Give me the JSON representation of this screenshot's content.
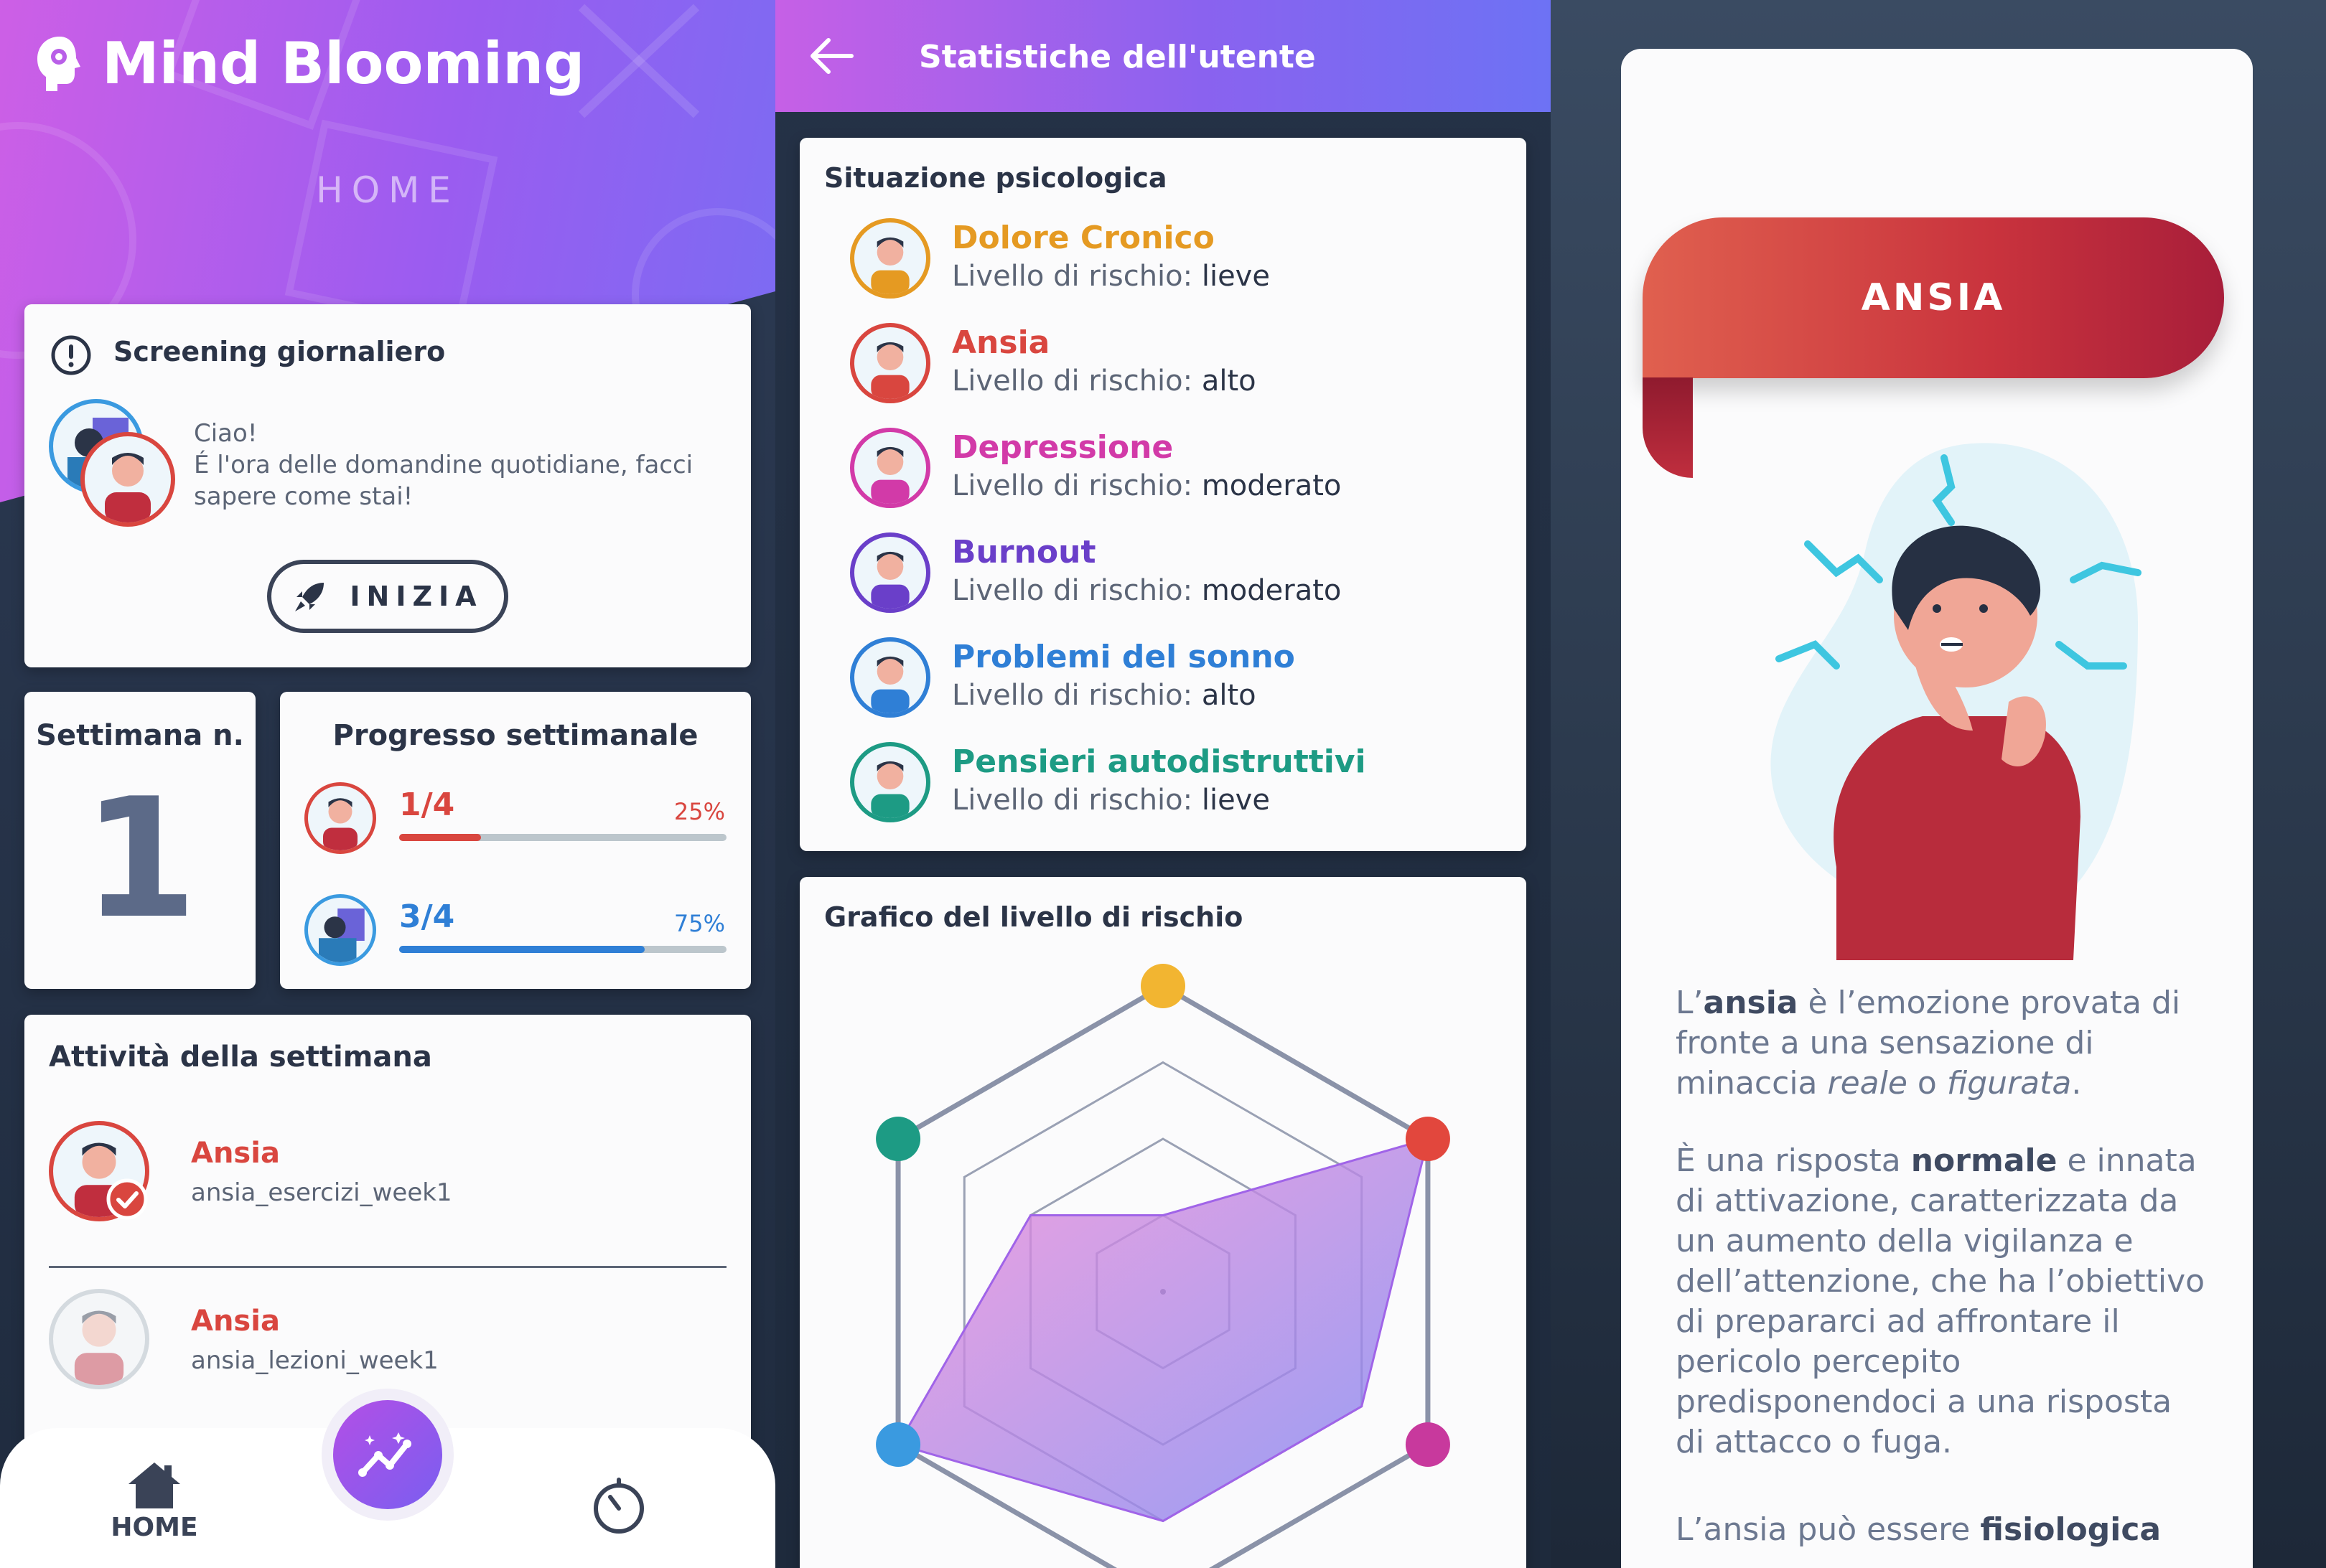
{
  "home": {
    "brand": "Mind Blooming",
    "section_title": "HOME",
    "screening": {
      "title": "Screening giornaliero",
      "greeting": "Ciao!",
      "message": "É l'ora delle domandine quotidiane, facci sapere come stai!",
      "start_label": "INIZIA"
    },
    "week": {
      "label": "Settimana n.",
      "number": "1"
    },
    "progress": {
      "title": "Progresso settimanale",
      "items": [
        {
          "fraction": "1/4",
          "percent_label": "25%",
          "value": 0.25,
          "color": "#d9463f"
        },
        {
          "fraction": "3/4",
          "percent_label": "75%",
          "value": 0.75,
          "color": "#2f7fd6"
        }
      ]
    },
    "activities": {
      "title": "Attività della settimana",
      "items": [
        {
          "title": "Ansia",
          "subtitle": "ansia_esercizi_week1"
        },
        {
          "title": "Ansia",
          "subtitle": "ansia_lezioni_week1"
        }
      ]
    },
    "nav": {
      "home_label": "HOME"
    }
  },
  "stats": {
    "title": "Statistiche dell'utente",
    "situation_title": "Situazione psicologica",
    "risk_prefix": "Livello di rischio:",
    "conditions": [
      {
        "name": "Dolore Cronico",
        "risk": "lieve",
        "color": "#e59a22"
      },
      {
        "name": "Ansia",
        "risk": "alto",
        "color": "#d9463f"
      },
      {
        "name": "Depressione",
        "risk": "moderato",
        "color": "#d23aa8"
      },
      {
        "name": "Burnout",
        "risk": "moderato",
        "color": "#6a3fc9"
      },
      {
        "name": "Problemi del sonno",
        "risk": "alto",
        "color": "#2f7fd6"
      },
      {
        "name": "Pensieri autodistruttivi",
        "risk": "lieve",
        "color": "#1d9b84"
      }
    ],
    "chart_title": "Grafico del livello di rischio"
  },
  "chart_data": {
    "type": "radar",
    "title": "Grafico del livello di rischio",
    "axes": [
      "Dolore Cronico",
      "Ansia",
      "Depressione",
      "Burnout",
      "Problemi del sonno",
      "Pensieri autodistruttivi"
    ],
    "axis_colors": [
      "#f2b531",
      "#e2473d",
      "#c8399d",
      "#6a3fc9",
      "#3a9ae0",
      "#1d9b84"
    ],
    "values": [
      0.25,
      1.0,
      0.75,
      0.75,
      1.0,
      0.5
    ],
    "range": [
      0,
      1
    ],
    "rings": 4
  },
  "article": {
    "title": "ANSIA",
    "p1": [
      "L’",
      "ansia",
      " è l’emozione provata di fronte a una sensazione di minaccia ",
      "reale",
      " o ",
      "figurata",
      "."
    ],
    "p2": [
      "È una risposta ",
      "normale",
      " e innata di attivazione, caratterizzata da un aumento della vigilanza e dell’attenzione, che ha l’obiettivo di prepararci ad affrontare il pericolo percepito predisponendoci a una risposta di attacco o fuga."
    ],
    "p3": [
      "L’ansia può essere ",
      "fisiologica"
    ]
  }
}
